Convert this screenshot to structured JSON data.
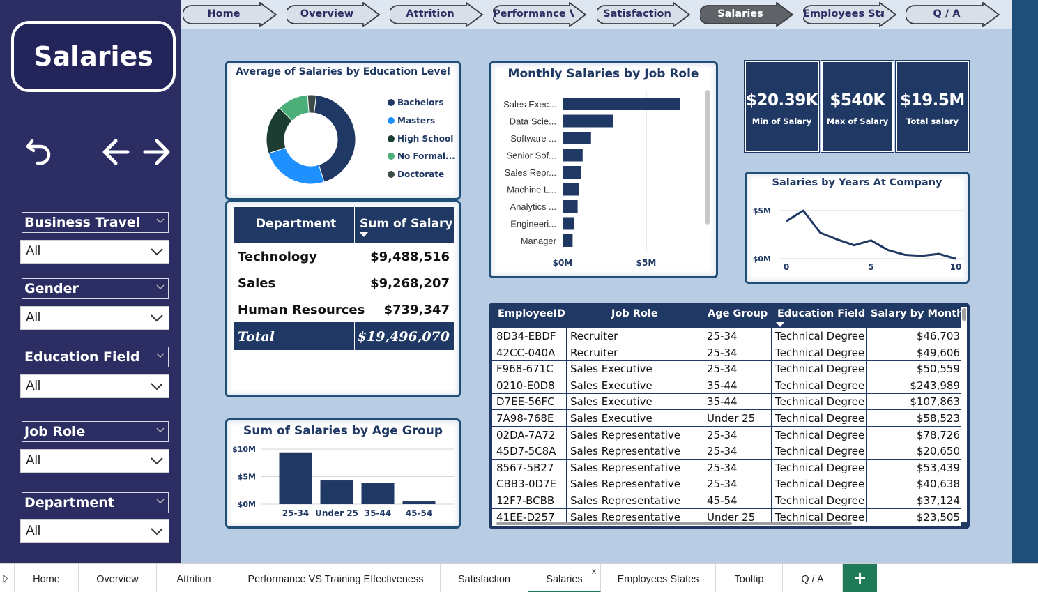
{
  "sidebar": {
    "title": "Salaries",
    "icons": {
      "back": "undo-arrow-icon",
      "prev": "arrow-left-icon",
      "next": "arrow-right-icon"
    },
    "slicers": [
      {
        "label": "Business Travel",
        "value": "All"
      },
      {
        "label": "Gender",
        "value": "All"
      },
      {
        "label": "Education Field",
        "value": "All"
      },
      {
        "label": "Job Role",
        "value": "All"
      },
      {
        "label": "Department",
        "value": "All"
      }
    ]
  },
  "nav_tabs": [
    {
      "label": "Home"
    },
    {
      "label": "Overview"
    },
    {
      "label": "Attrition"
    },
    {
      "label": "Performance V..."
    },
    {
      "label": "Satisfaction"
    },
    {
      "label": "Salaries"
    },
    {
      "label": "Employees States"
    },
    {
      "label": "Q / A"
    }
  ],
  "active_nav_tab": "Salaries",
  "education_donut": {
    "title": "Average of Salaries by Education Level",
    "legend": [
      "Bachelors",
      "Masters",
      "High School",
      "No Formal...",
      "Doctorate"
    ]
  },
  "dept_table": {
    "headers": [
      "Department",
      "Sum of Salary"
    ],
    "rows": [
      {
        "dept": "Technology",
        "salary": "$9,488,516"
      },
      {
        "dept": "Sales",
        "salary": "$9,268,207"
      },
      {
        "dept": "Human Resources",
        "salary": "$739,347"
      }
    ],
    "total_label": "Total",
    "total_value": "$19,496,070"
  },
  "job_role_chart": {
    "title": "Monthly Salaries by Job Role"
  },
  "kpis": [
    {
      "value": "$20.39K",
      "label": "Min of Salary"
    },
    {
      "value": "$540K",
      "label": "Max of Salary"
    },
    {
      "value": "$19.5M",
      "label": "Total salary"
    }
  ],
  "years_chart": {
    "title": "Salaries by Years At Company"
  },
  "age_chart": {
    "title": "Sum of Salaries by Age Group"
  },
  "employee_table": {
    "headers": [
      "EmployeeID",
      "Job Role",
      "Age Group",
      "Education Field",
      "Salary by Month"
    ],
    "rows": [
      [
        "8D34-EBDF",
        "Recruiter",
        "25-34",
        "Technical Degree",
        "$46,703"
      ],
      [
        "42CC-040A",
        "Recruiter",
        "25-34",
        "Technical Degree",
        "$49,606"
      ],
      [
        "F968-671C",
        "Sales Executive",
        "25-34",
        "Technical Degree",
        "$50,559"
      ],
      [
        "0210-E0D8",
        "Sales Executive",
        "35-44",
        "Technical Degree",
        "$243,989"
      ],
      [
        "D7EE-56FC",
        "Sales Executive",
        "35-44",
        "Technical Degree",
        "$107,863"
      ],
      [
        "7A98-768E",
        "Sales Executive",
        "Under 25",
        "Technical Degree",
        "$58,523"
      ],
      [
        "02DA-7A72",
        "Sales Representative",
        "25-34",
        "Technical Degree",
        "$78,726"
      ],
      [
        "45D7-5C8A",
        "Sales Representative",
        "25-34",
        "Technical Degree",
        "$20,650"
      ],
      [
        "8567-5B27",
        "Sales Representative",
        "25-34",
        "Technical Degree",
        "$53,439"
      ],
      [
        "CBB3-0D7E",
        "Sales Representative",
        "25-34",
        "Technical Degree",
        "$40,638"
      ],
      [
        "12F7-BCBB",
        "Sales Representative",
        "45-54",
        "Technical Degree",
        "$37,124"
      ],
      [
        "41EE-D257",
        "Sales Representative",
        "Under 25",
        "Technical Degree",
        "$23,505"
      ]
    ]
  },
  "sheet_tabs": [
    "Home",
    "Overview",
    "Attrition",
    "Performance VS Training Effectiveness",
    "Satisfaction",
    "Salaries",
    "Employees States",
    "Tooltip",
    "Q / A"
  ],
  "active_sheet": "Salaries",
  "sheet_close": "x",
  "add_sheet": "+",
  "colors": {
    "navy": "#1f3864",
    "sidebar": "#2b2d63",
    "canvas": "#b8cce4",
    "masters": "#1e90ff",
    "high_school": "#1c3d32",
    "no_formal": "#4caf7a",
    "doctorate": "#3b4a48",
    "accent_green": "#1f7a58"
  },
  "chart_data": [
    {
      "type": "pie",
      "title": "Average of Salaries by Education Level",
      "categories": [
        "Bachelors",
        "Masters",
        "High School",
        "No Formal...",
        "Doctorate"
      ],
      "values": [
        42,
        24,
        17,
        11,
        3
      ],
      "donut": true
    },
    {
      "type": "bar",
      "orientation": "horizontal",
      "title": "Monthly Salaries by Job Role",
      "categories": [
        "Sales Exec...",
        "Data Scie...",
        "Software ...",
        "Senior Sof...",
        "Sales Repr...",
        "Machine L...",
        "Analytics ...",
        "Engineeri...",
        "Manager"
      ],
      "values": [
        7.0,
        3.0,
        1.7,
        1.2,
        1.1,
        1.0,
        0.9,
        0.7,
        0.6
      ],
      "unit": "M",
      "xticks": [
        "$0M",
        "$5M"
      ],
      "xlim": [
        0,
        9
      ]
    },
    {
      "type": "line",
      "title": "Salaries by Years At Company",
      "x": [
        0,
        1,
        2,
        3,
        4,
        5,
        6,
        7,
        8,
        9,
        10
      ],
      "y": [
        3.9,
        5.0,
        2.7,
        2.0,
        1.4,
        1.9,
        0.9,
        0.4,
        0.3,
        0.5,
        0.0
      ],
      "unit": "M",
      "xticks": [
        "0",
        "5",
        "10"
      ],
      "yticks": [
        "$0M",
        "$5M"
      ],
      "ylim": [
        0,
        5.5
      ],
      "grid": true
    },
    {
      "type": "bar",
      "title": "Sum of Salaries by Age Group",
      "categories": [
        "25-34",
        "Under 25",
        "35-44",
        "45-54"
      ],
      "values": [
        9.4,
        4.3,
        3.9,
        0.5
      ],
      "unit": "M",
      "yticks": [
        "$0M",
        "$5M",
        "$10M"
      ],
      "ylim": [
        0,
        10.5
      ],
      "grid": true
    }
  ]
}
